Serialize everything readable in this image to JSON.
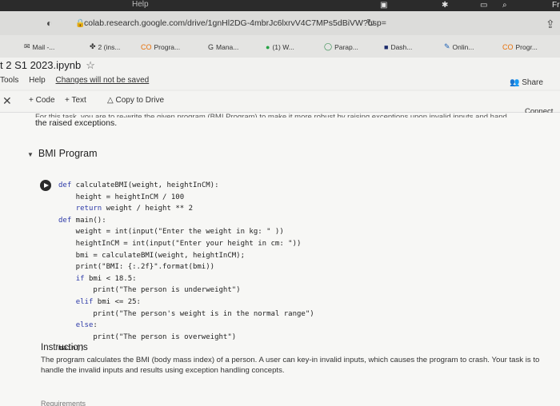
{
  "browser": {
    "menubar_label": "Help",
    "address_url": "colab.research.google.com/drive/1gnHl2DG-4mbrJc6lxrvV4C7MPs5dBiVW?usp=",
    "bookmarks": [
      {
        "label": "Mail -...",
        "icon": "mail-icon"
      },
      {
        "label": "2 (ins...",
        "icon": "bookmark-icon"
      },
      {
        "label": "Progra...",
        "icon": "colab-icon"
      },
      {
        "label": "Mana...",
        "icon": "google-icon"
      },
      {
        "label": "(1) W...",
        "icon": "whatsapp-icon"
      },
      {
        "label": "Parap...",
        "icon": "quillbot-icon"
      },
      {
        "label": "Dash...",
        "icon": "dashboard-icon"
      },
      {
        "label": "Onlin...",
        "icon": "pen-icon"
      },
      {
        "label": "Progr...",
        "icon": "colab-icon"
      }
    ],
    "system_text": "Fr"
  },
  "notebook": {
    "title": "t 2 S1 2023.ipynb",
    "menus": [
      "Tools",
      "Help"
    ],
    "unsaved_notice": "Changes will not be saved",
    "share_label": "Share",
    "toolbar": {
      "code_label": "+ Code",
      "text_label": "+ Text",
      "copy_label": "Copy to Drive",
      "connect_label": "Connect"
    }
  },
  "cells": {
    "cut_text": "For this task, you are to re-write the given program (BMI Program) to make it more robust by raising exceptions upon invalid inputs and hand",
    "raised_text": "the raised exceptions.",
    "section_title": "BMI Program",
    "code_lines": [
      "def calculateBMI(weight, heightInCM):",
      "    height = heightInCM / 100",
      "    return weight / height ** 2",
      "def main():",
      "    weight = int(input(\"Enter the weight in kg: \" ))",
      "    heightInCM = int(input(\"Enter your height in cm: \"))",
      "    bmi = calculateBMI(weight, heightInCM);",
      "    print(\"BMI: {:.2f}\".format(bmi))",
      "    if bmi < 18.5:",
      "        print(\"The person is underweight\")",
      "    elif bmi <= 25:",
      "        print(\"The person's weight is in the normal range\")",
      "    else:",
      "        print(\"The person is overweight\")",
      "main()"
    ],
    "instructions_title": "Instructions",
    "instructions_text": "The program calculates the BMI (body mass index) of a person. A user can key-in invalid inputs, which causes the program to crash. Your task is to handle the invalid inputs and results using exception handling concepts.",
    "bottom_cut": "Requirements"
  }
}
